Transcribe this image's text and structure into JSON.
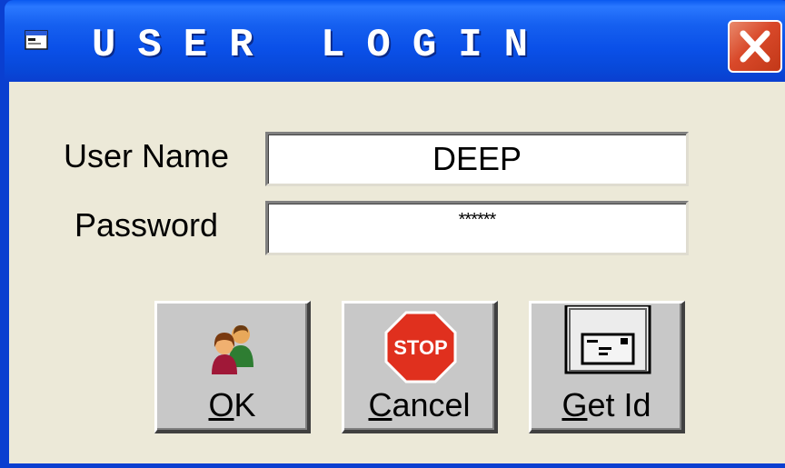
{
  "window": {
    "title": "USER LOGIN",
    "title_icon": "window-icon",
    "close_icon": "close-icon"
  },
  "form": {
    "username_label": "User Name",
    "username_value": "DEEP",
    "password_label": "Password",
    "password_value": "******"
  },
  "buttons": {
    "ok": {
      "accel": "O",
      "rest": "K",
      "icon": "users-icon"
    },
    "cancel": {
      "accel": "C",
      "rest": "ancel",
      "icon": "stop-sign-icon",
      "icon_text": "STOP"
    },
    "getid": {
      "accel": "G",
      "rest": "et Id",
      "icon": "id-card-icon"
    }
  },
  "colors": {
    "titlebar": "#0a50e8",
    "close": "#d9492a",
    "face": "#ece9d8",
    "stop": "#e0301e"
  }
}
